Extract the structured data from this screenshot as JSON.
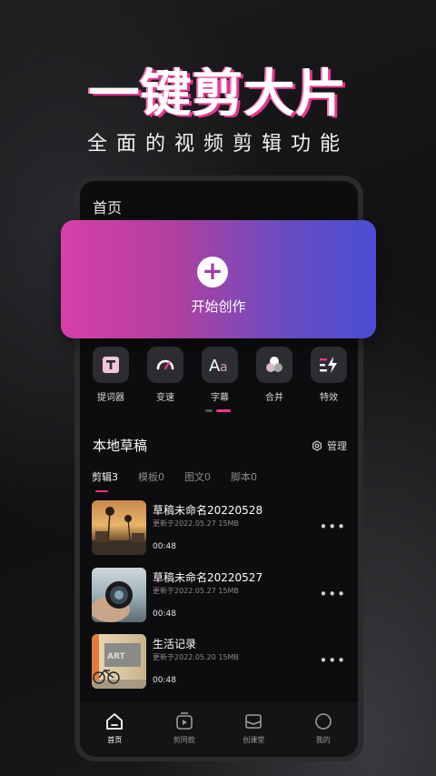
{
  "promo": {
    "headline": "一键剪大片",
    "subheadline": "全面的视频剪辑功能"
  },
  "screen": {
    "title": "首页",
    "create_label": "开始创作",
    "tools": [
      {
        "label": "提词器",
        "icon": "teleprompter-icon"
      },
      {
        "label": "变速",
        "icon": "speed-gauge-icon"
      },
      {
        "label": "字幕",
        "icon": "subtitle-icon"
      },
      {
        "label": "合并",
        "icon": "merge-icon"
      },
      {
        "label": "特效",
        "icon": "effects-icon"
      }
    ],
    "drafts_title": "本地草稿",
    "manage_label": "管理",
    "tabs": [
      "剪辑3",
      "模板0",
      "图文0",
      "脚本0"
    ],
    "drafts": [
      {
        "title": "草稿未命名20220528",
        "meta": "更新于2022.05.27  15MB",
        "duration": "00:48"
      },
      {
        "title": "草稿未命名20220527",
        "meta": "更新于2022.05.27  15MB",
        "duration": "00:48"
      },
      {
        "title": "生活记录",
        "meta": "更新于2022.05.20  15MB",
        "duration": "00:48"
      }
    ],
    "bottom_nav": [
      {
        "label": "首页",
        "icon": "home-icon"
      },
      {
        "label": "剪同款",
        "icon": "template-icon"
      },
      {
        "label": "创课堂",
        "icon": "classroom-icon"
      },
      {
        "label": "我的",
        "icon": "profile-icon"
      }
    ]
  },
  "colors": {
    "accent": "#e8358f",
    "card_start": "#d640a8",
    "card_end": "#4a4dd6"
  }
}
